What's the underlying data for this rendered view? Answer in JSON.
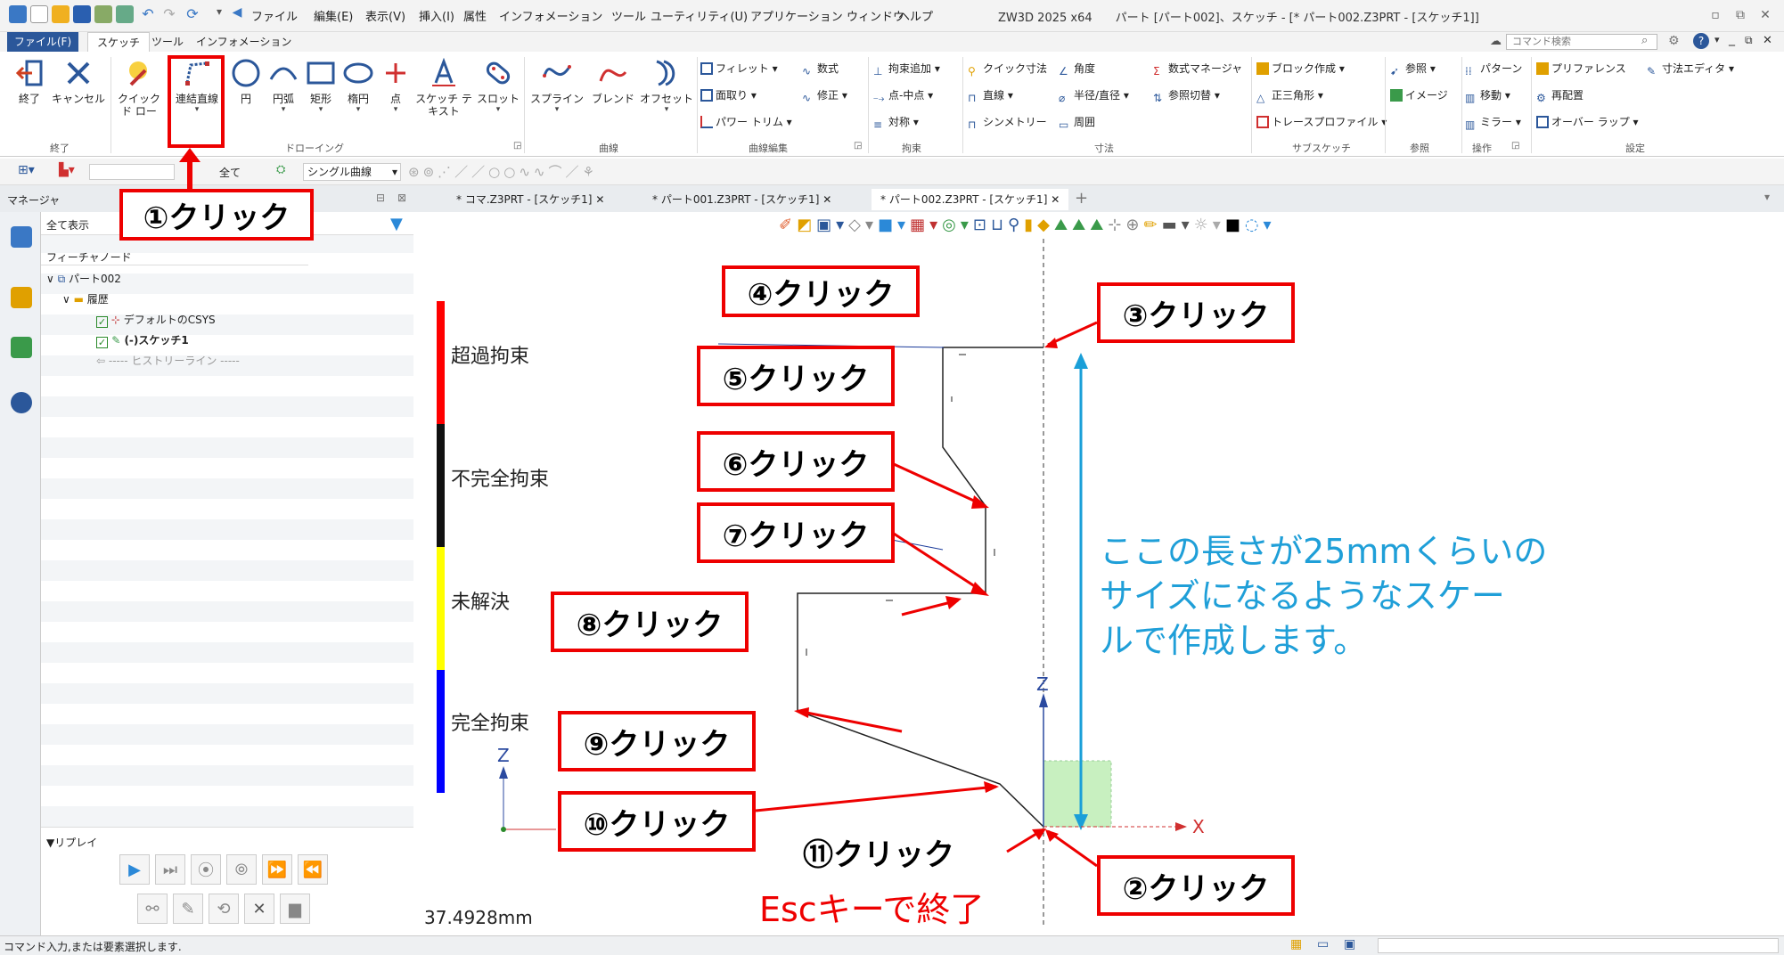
{
  "app": {
    "title": "ZW3D 2025 x64　　パート [パート002]、スケッチ - [* パート002.Z3PRT - [スケッチ1]]",
    "menu": [
      "ファイル",
      "編集(E)",
      "表示(V)",
      "挿入(I)",
      "属性",
      "インフォメーション",
      "ツール",
      "ユーティリティ(U)",
      "アプリケーション",
      "ウィンドウ",
      "ヘルプ"
    ]
  },
  "ribbon": {
    "tabs": [
      "ファイル(F)",
      "スケッチ",
      "ツール",
      "インフォメーション"
    ],
    "search_placeholder": "コマンド検索",
    "big_buttons": {
      "end": "終了",
      "cancel": "キャンセル",
      "quick_draw": "クイック ド ロー",
      "polyline": "連結直線",
      "circle": "円",
      "arc": "円弧",
      "rect": "矩形",
      "ellipse": "楕円",
      "point": "点",
      "sketch_text": "スケッチ テ キスト",
      "slot": "スロット",
      "spline": "スプライン",
      "blend": "ブレンド",
      "offset": "オフセット"
    },
    "small": {
      "fillet": "フィレット",
      "chamfer": "面取り",
      "power_trim": "パワー トリム",
      "formula": "数式",
      "modify": "修正",
      "add_constraint": "拘束追加",
      "point_mid": "点-中点",
      "symmetric": "対称",
      "quick_dim": "クイック寸法",
      "linear": "直線",
      "symmetry": "シンメトリー",
      "angle": "角度",
      "radius": "半径/直径",
      "perimeter": "周囲",
      "formula_mgr": "数式マネージャ",
      "ref_switch": "参照切替",
      "block": "ブロック作成",
      "polygon": "正三角形",
      "trace": "トレースプロファイル",
      "reference": "参照",
      "image": "イメージ",
      "pattern": "パターン",
      "move": "移動",
      "mirror": "ミラー",
      "preference": "プリファレンス",
      "relayout": "再配置",
      "overlap": "オーバー ラップ",
      "dim_editor": "寸法エディタ"
    },
    "groups": [
      "終了",
      "ドローイング",
      "曲線",
      "曲線編集",
      "拘束",
      "寸法",
      "サブスケッチ",
      "参照",
      "操作",
      "設定"
    ]
  },
  "toolbar2": {
    "filter_all": "全て",
    "curve_mode": "シングル曲線"
  },
  "doc_tabs": [
    "* コマ.Z3PRT - [スケッチ1]",
    "* パート001.Z3PRT - [スケッチ1]",
    "* パート002.Z3PRT - [スケッチ1]"
  ],
  "manager": {
    "title": "マネージャ",
    "filter": "全て表示",
    "column": "フィーチャノード",
    "tree": [
      "パート002",
      "履歴",
      "デフォルトのCSYS",
      "(-)スケッチ1",
      "----- ヒストリーライン -----"
    ],
    "replay": "▼リプレイ"
  },
  "canvas": {
    "constraint_legend": [
      {
        "label": "超過拘束",
        "color": "#ff0000"
      },
      {
        "label": "不完全拘束",
        "color": "#111111"
      },
      {
        "label": "未解決",
        "color": "#ffff00"
      },
      {
        "label": "完全拘束",
        "color": "#0000ff"
      }
    ],
    "callouts": [
      "①クリック",
      "②クリック",
      "③クリック",
      "④クリック",
      "⑤クリック",
      "⑥クリック",
      "⑦クリック",
      "⑧クリック",
      "⑨クリック",
      "⑩クリック",
      "⑪クリック"
    ],
    "note": [
      "ここの長さが25mmくらいの",
      "サイズになるようなスケー",
      "ルで作成します。"
    ],
    "esc_note": "Escキーで終了",
    "length_readout": "37.4928mm",
    "axis_x": "X",
    "axis_z": "Z"
  },
  "status": {
    "text": "コマンド入力,または要素選択します."
  },
  "colors": {
    "callout_border": "#e00000",
    "note": "#1f9fd8",
    "file_tab": "#2b579a"
  }
}
